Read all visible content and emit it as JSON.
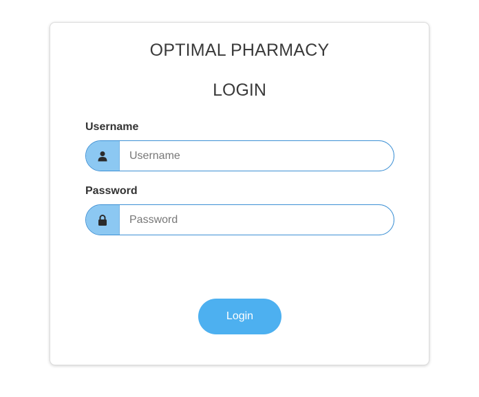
{
  "brand": {
    "title": "OPTIMAL PHARMACY"
  },
  "form": {
    "heading": "LOGIN",
    "username": {
      "label": "Username",
      "placeholder": "Username",
      "value": "",
      "icon": "user-icon"
    },
    "password": {
      "label": "Password",
      "placeholder": "Password",
      "value": "",
      "icon": "lock-icon"
    },
    "submit_label": "Login"
  },
  "colors": {
    "accent": "#4db0f0",
    "addon_bg": "#8cc8f2",
    "field_border": "#3b8fd4",
    "text_dark": "#3a3a3a"
  }
}
